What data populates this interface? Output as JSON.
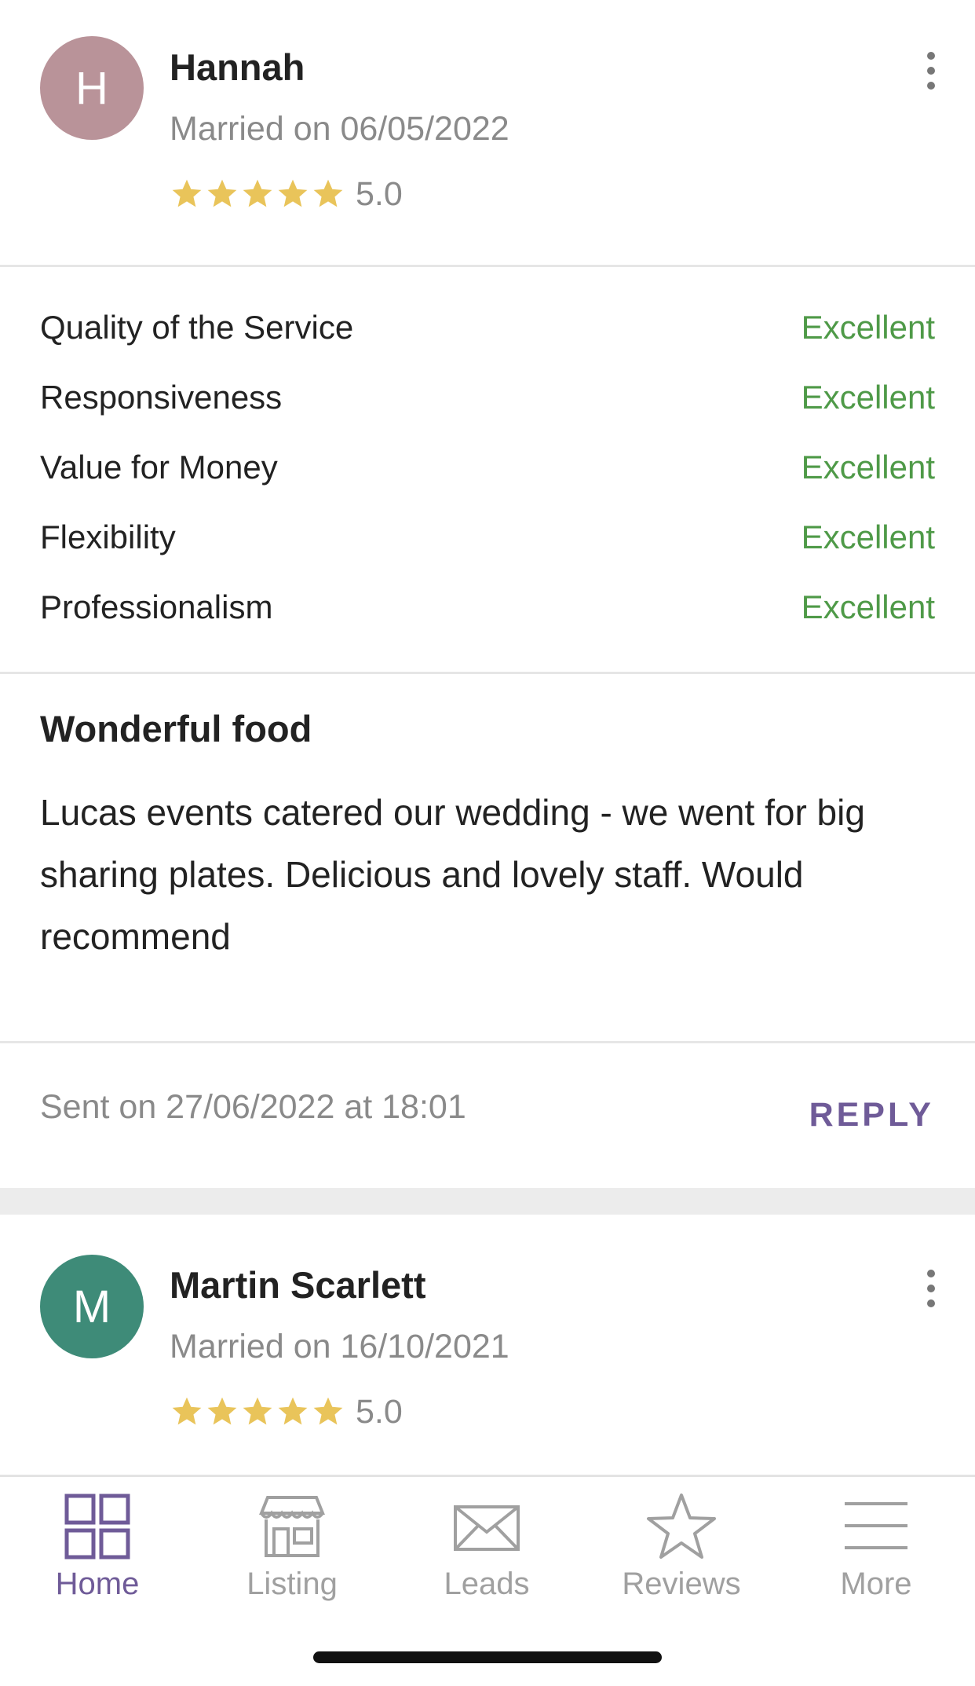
{
  "reviews": [
    {
      "initial": "H",
      "avatar_color": "#b99399",
      "name": "Hannah",
      "married": "Married on 06/05/2022",
      "rating": "5.0",
      "stars": 5,
      "criteria": [
        {
          "label": "Quality of the Service",
          "value": "Excellent"
        },
        {
          "label": "Responsiveness",
          "value": "Excellent"
        },
        {
          "label": "Value for Money",
          "value": "Excellent"
        },
        {
          "label": "Flexibility",
          "value": "Excellent"
        },
        {
          "label": "Professionalism",
          "value": "Excellent"
        }
      ],
      "title": "Wonderful food",
      "body": "Lucas events catered our wedding - we went for big sharing plates. Delicious and lovely staff. Would recommend",
      "sent": "Sent on 27/06/2022 at 18:01",
      "reply_label": "REPLY"
    },
    {
      "initial": "M",
      "avatar_color": "#3e8b78",
      "name": "Martin Scarlett",
      "married": "Married on 16/10/2021",
      "rating": "5.0",
      "stars": 5
    }
  ],
  "nav": {
    "items": [
      {
        "label": "Home",
        "icon": "grid-icon",
        "active": true
      },
      {
        "label": "Listing",
        "icon": "storefront-icon",
        "active": false
      },
      {
        "label": "Leads",
        "icon": "envelope-icon",
        "active": false
      },
      {
        "label": "Reviews",
        "icon": "star-icon",
        "active": false
      },
      {
        "label": "More",
        "icon": "menu-icon",
        "active": false
      }
    ],
    "active_color": "#6f5b98",
    "inactive_color": "#a0a0a0"
  },
  "colors": {
    "star": "#e9c45a",
    "excellent": "#4f9a48",
    "accent": "#6f5b98"
  }
}
